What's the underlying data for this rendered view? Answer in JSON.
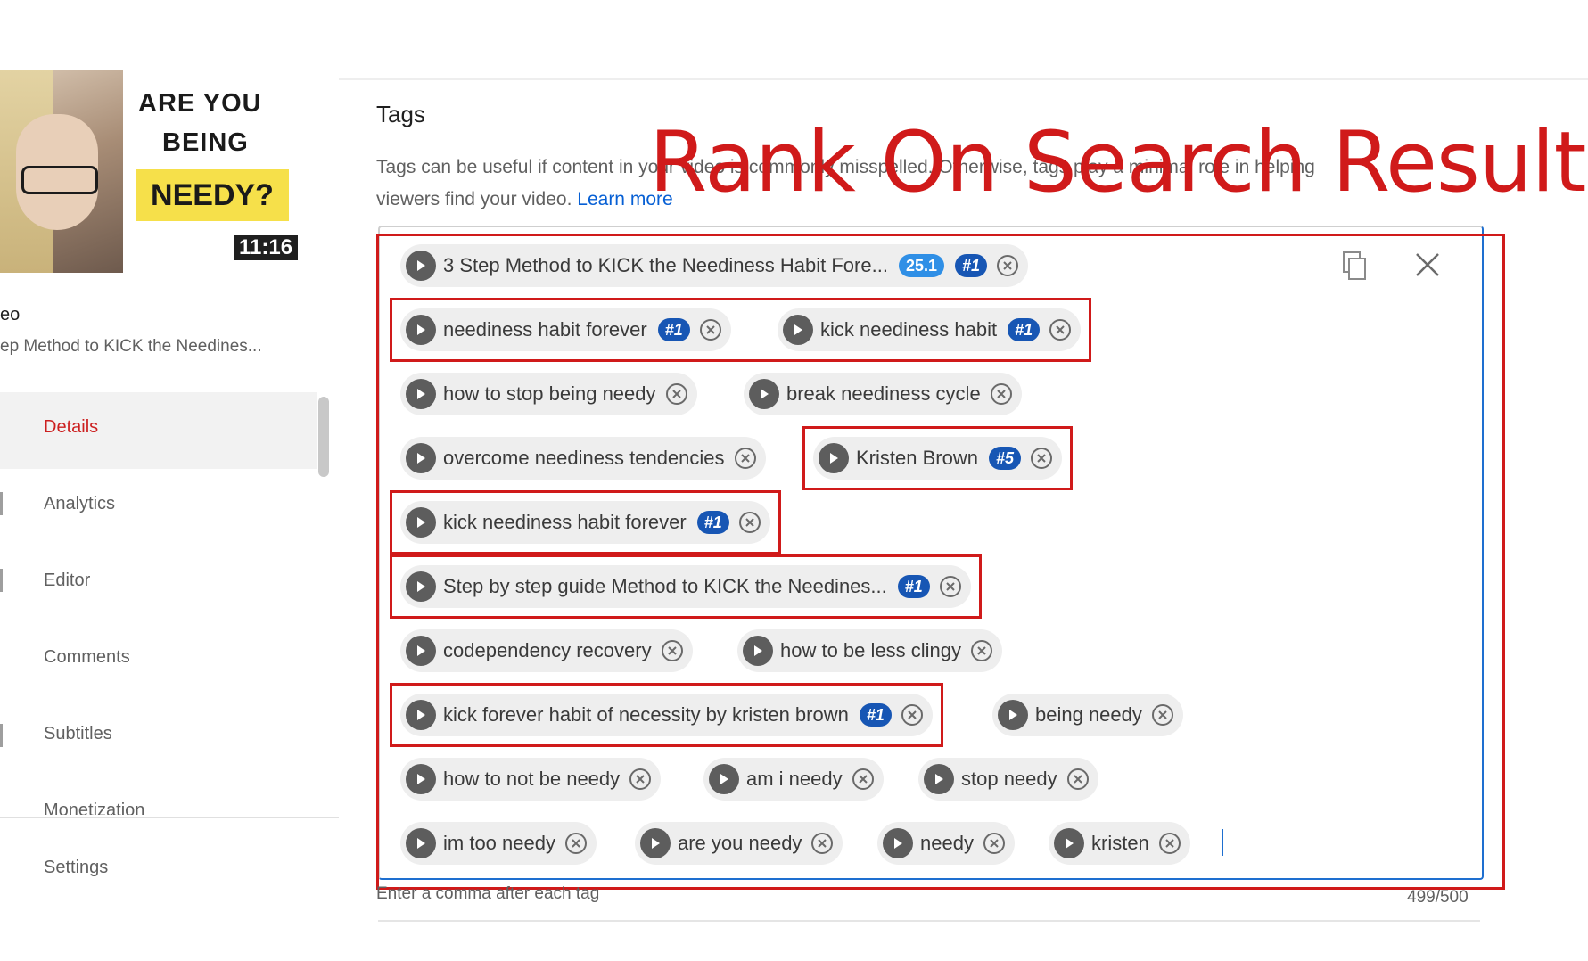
{
  "thumbnail": {
    "line1": "ARE YOU",
    "line2": "BEING",
    "highlight": "NEEDY?",
    "duration": "11:16"
  },
  "sidebar": {
    "title": "eo",
    "subtitle": "ep Method to KICK the Needines...",
    "items": [
      {
        "label": "Details",
        "active": true
      },
      {
        "label": "Analytics",
        "active": false
      },
      {
        "label": "Editor",
        "active": false
      },
      {
        "label": "Comments",
        "active": false
      },
      {
        "label": "Subtitles",
        "active": false
      },
      {
        "label": "Monetization",
        "active": false
      },
      {
        "label": "Settings",
        "active": false
      }
    ]
  },
  "tags_section": {
    "heading": "Tags",
    "description_line1": "Tags can be useful if content in your video is commonly misspelled. Otherwise, tags play a minimal role in helping",
    "description_line2": "viewers find your video.",
    "learn_more": "Learn more",
    "overlay_title": "Rank On Search Result",
    "hint": "Enter a comma after each tag",
    "counter": "499/500",
    "colors": {
      "highlight": "#d01a1a",
      "rank_badge": "#1756b4",
      "score_badge": "#2f8fe6",
      "link": "#065fd4"
    },
    "icons": {
      "copy": "copy-icon",
      "clear": "close-icon",
      "tag_lead": "play-icon",
      "remove": "remove-circle-icon"
    }
  },
  "tags": [
    {
      "label": "3 Step Method to KICK the Neediness Habit Fore...",
      "score": "25.1",
      "rank": "#1"
    },
    {
      "label": "neediness habit forever",
      "rank": "#1"
    },
    {
      "label": "kick neediness habit",
      "rank": "#1"
    },
    {
      "label": "how to stop being needy"
    },
    {
      "label": "break neediness cycle"
    },
    {
      "label": "overcome neediness tendencies"
    },
    {
      "label": "Kristen Brown",
      "rank": "#5"
    },
    {
      "label": "kick neediness habit forever",
      "rank": "#1"
    },
    {
      "label": "Step by step guide Method to KICK the Needines...",
      "rank": "#1"
    },
    {
      "label": "codependency recovery"
    },
    {
      "label": "how to be less clingy"
    },
    {
      "label": "kick forever habit of necessity by kristen brown",
      "rank": "#1"
    },
    {
      "label": "being needy"
    },
    {
      "label": "how to not be needy"
    },
    {
      "label": "am i needy"
    },
    {
      "label": "stop needy"
    },
    {
      "label": "im too needy"
    },
    {
      "label": "are you needy"
    },
    {
      "label": "needy"
    },
    {
      "label": "kristen"
    }
  ]
}
